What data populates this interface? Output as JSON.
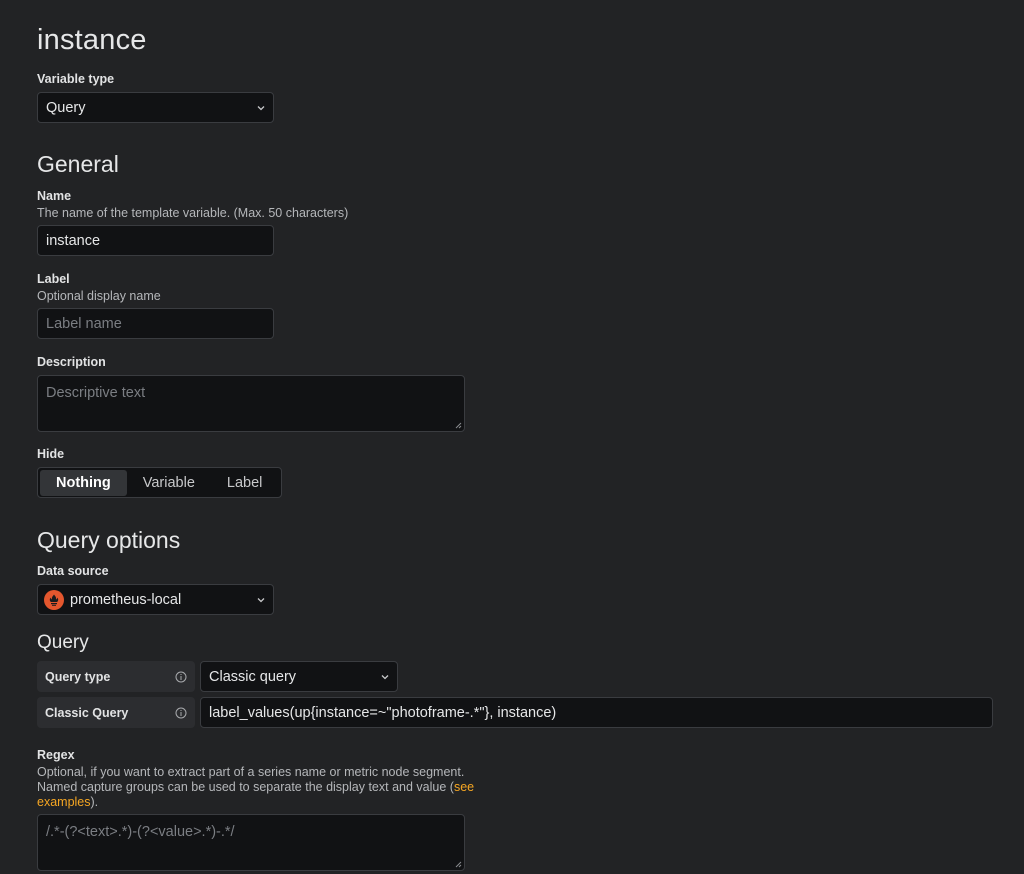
{
  "variable": {
    "title": "instance"
  },
  "variable_type": {
    "label": "Variable type",
    "value": "Query"
  },
  "general": {
    "heading": "General",
    "name": {
      "label": "Name",
      "description": "The name of the template variable. (Max. 50 characters)",
      "value": "instance"
    },
    "label": {
      "label": "Label",
      "description": "Optional display name",
      "placeholder": "Label name"
    },
    "description": {
      "label": "Description",
      "placeholder": "Descriptive text"
    },
    "hide": {
      "label": "Hide",
      "options": [
        "Nothing",
        "Variable",
        "Label"
      ],
      "selected": "Nothing"
    }
  },
  "query_options": {
    "heading": "Query options",
    "data_source": {
      "label": "Data source",
      "value": "prometheus-local",
      "icon": "prometheus-icon",
      "icon_color": "#e4572e"
    }
  },
  "query": {
    "heading": "Query",
    "query_type": {
      "label": "Query type",
      "value": "Classic query"
    },
    "classic_query": {
      "label": "Classic Query",
      "value": "label_values(up{instance=~\"photoframe-.*\"}, instance)"
    }
  },
  "regex": {
    "label": "Regex",
    "description_line1": "Optional, if you want to extract part of a series name or metric node segment.",
    "description_line2_prefix": "Named capture groups can be used to separate the display text and value (",
    "link_part1": "see",
    "link_part2": "examples",
    "description_line3_suffix": ").",
    "placeholder": "/.*-(?<text>.*)-(?<value>.*)-.*/"
  },
  "colors": {
    "background": "#222325",
    "input_bg": "#111214",
    "accent_link": "#f5a623"
  }
}
